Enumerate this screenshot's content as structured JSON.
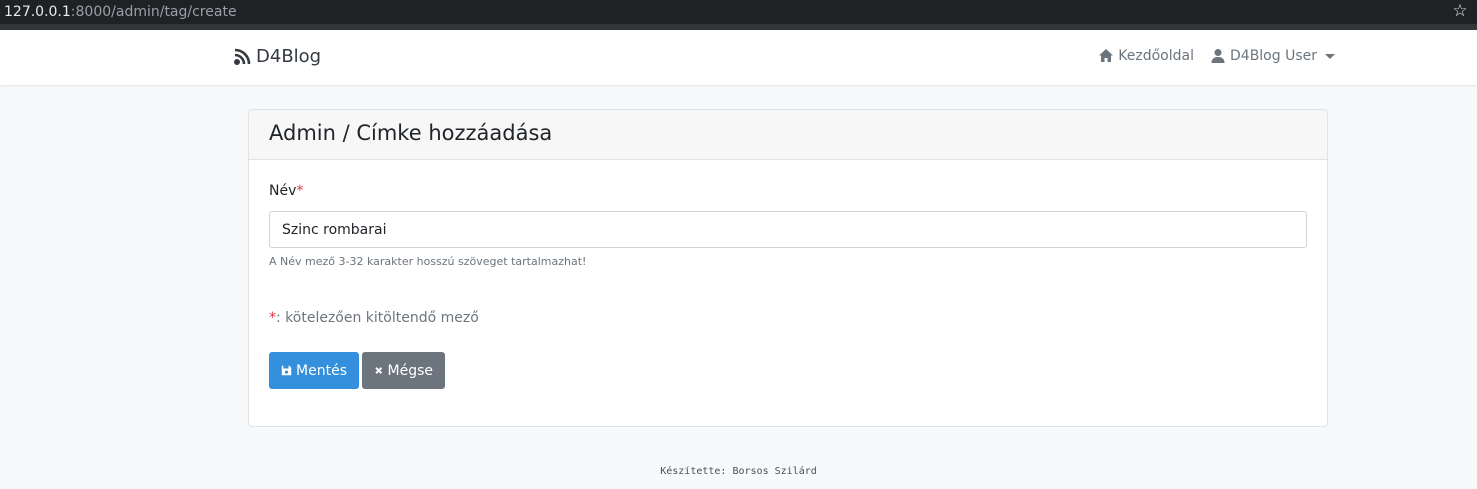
{
  "browser": {
    "url_host": "127.0.0.1",
    "url_path": ":8000/admin/tag/create"
  },
  "navbar": {
    "brand": "D4Blog",
    "home_label": "Kezdőoldal",
    "user_label": "D4Blog User"
  },
  "card": {
    "title": "Admin / Címke hozzáadása",
    "name_label": "Név",
    "required_mark": "*",
    "name_value": "Szinc rombarai",
    "help_text": "A Név mező 3-32 karakter hosszú szöveget tartalmazhat!",
    "required_note_mark": "*",
    "required_note": ": kötelezően kitöltendő mező",
    "save_label": "Mentés",
    "cancel_label": "Mégse"
  },
  "footer": {
    "text": "Készítette: Borsos Szilárd"
  },
  "colors": {
    "primary": "#3490dc",
    "secondary": "#6c757d",
    "danger": "#dc3545"
  }
}
